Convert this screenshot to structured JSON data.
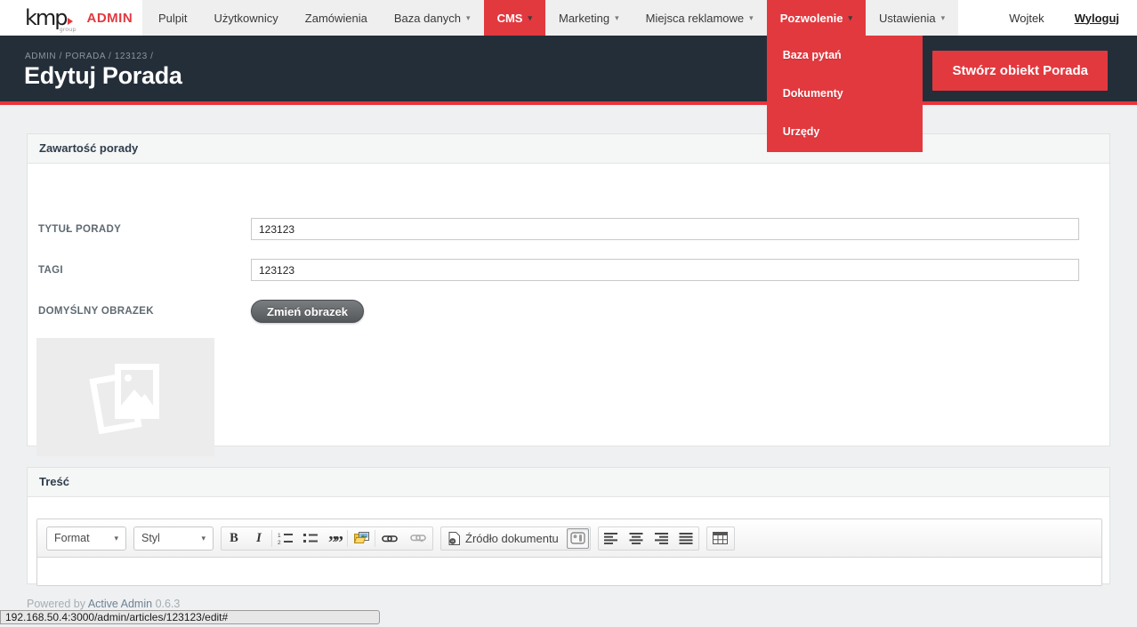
{
  "brand": {
    "logo": "kmp",
    "logo_sub": "group",
    "admin": "ADMIN"
  },
  "nav": {
    "items": [
      {
        "label": "Pulpit"
      },
      {
        "label": "Użytkownicy"
      },
      {
        "label": "Zamówienia"
      },
      {
        "label": "Baza danych"
      },
      {
        "label": "CMS"
      },
      {
        "label": "Marketing"
      },
      {
        "label": "Miejsca reklamowe"
      },
      {
        "label": "Pozwolenie"
      },
      {
        "label": "Ustawienia"
      }
    ],
    "user_name": "Wojtek",
    "logout_label": "Wyloguj"
  },
  "dropdown": {
    "items": [
      {
        "label": "Baza pytań"
      },
      {
        "label": "Dokumenty"
      },
      {
        "label": "Urzędy"
      }
    ]
  },
  "page_header": {
    "breadcrumb": "ADMIN / PORADA / 123123 /",
    "title": "Edytuj Porada",
    "action_label": "Stwórz obiekt Porada"
  },
  "content_panel": {
    "title": "Zawartość porady",
    "fields": [
      {
        "label": "TYTUŁ PORADY",
        "value": "123123"
      },
      {
        "label": "TAGI",
        "value": "123123"
      }
    ],
    "image_field": {
      "label": "DOMYŚLNY OBRAZEK",
      "button_label": "Zmień obrazek"
    }
  },
  "tresc_panel": {
    "title": "Treść",
    "toolbar": {
      "format_label": "Format",
      "styl_label": "Styl",
      "bold": "B",
      "italic": "I",
      "quote": "””",
      "source_label": "Źródło dokumentu"
    }
  },
  "footer": {
    "powered_by": "Powered by",
    "link_label": "Active Admin",
    "version": "0.6.3"
  },
  "status_bar": {
    "url": "192.168.50.4:3000/admin/articles/123123/edit#"
  },
  "icons": {
    "caret": "▾"
  },
  "colors": {
    "accent_red": "#e2393f",
    "header_dark": "#242e39"
  }
}
